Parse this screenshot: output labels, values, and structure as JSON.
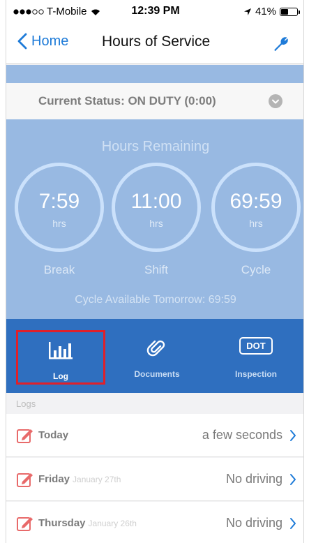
{
  "status_bar": {
    "carrier": "T-Mobile",
    "time": "12:39 PM",
    "battery_text": "41%",
    "battery_level": 0.41
  },
  "nav": {
    "back_label": "Home",
    "title": "Hours of Service"
  },
  "current_status": "Current Status: ON DUTY (0:00)",
  "hours": {
    "title": "Hours Remaining",
    "rings": [
      {
        "value": "7:59",
        "unit": "hrs",
        "label": "Break"
      },
      {
        "value": "11:00",
        "unit": "hrs",
        "label": "Shift"
      },
      {
        "value": "69:59",
        "unit": "hrs",
        "label": "Cycle"
      }
    ],
    "cycle_tomorrow": "Cycle Available Tomorrow: 69:59"
  },
  "tabs": {
    "log": "Log",
    "documents": "Documents",
    "inspection": "Inspection",
    "dot_badge": "DOT"
  },
  "logs": {
    "header": "Logs",
    "rows": [
      {
        "day": "Today",
        "date": "",
        "value": "a few seconds"
      },
      {
        "day": "Friday",
        "date": "January 27th",
        "value": "No driving"
      },
      {
        "day": "Thursday",
        "date": "January 26th",
        "value": "No driving"
      }
    ]
  },
  "colors": {
    "accent": "#1e7bd8",
    "tab_bar": "#2f6fbf",
    "hours_panel": "#98b9e2",
    "highlight": "#e0202a",
    "edit_icon": "#e86a6a"
  }
}
